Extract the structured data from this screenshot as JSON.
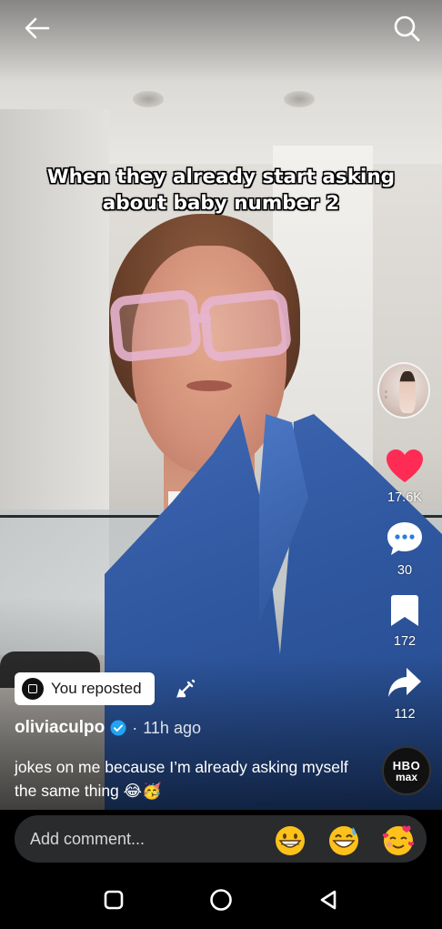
{
  "video": {
    "caption": "When they already start asking about baby number 2"
  },
  "header": {
    "back_icon": "arrow-left-icon",
    "search_icon": "search-icon"
  },
  "actions": {
    "likes": "17.6K",
    "comments": "30",
    "saves": "172",
    "shares": "112"
  },
  "repost": {
    "label": "You reposted"
  },
  "post": {
    "author": "oliviaculpo",
    "time_ago": "11h ago",
    "separator": "·",
    "description": "jokes on me because I’m already asking myself the same thing 😂🥳"
  },
  "hbo": {
    "line1": "HBO",
    "line2": "max"
  },
  "comment_bar": {
    "placeholder": "Add comment...",
    "emojis": [
      "😁",
      "😅",
      "🥰"
    ]
  },
  "colors": {
    "like": "#fe2c55",
    "verified": "#20a4f3",
    "comment_bg": "#2a2b2d"
  }
}
